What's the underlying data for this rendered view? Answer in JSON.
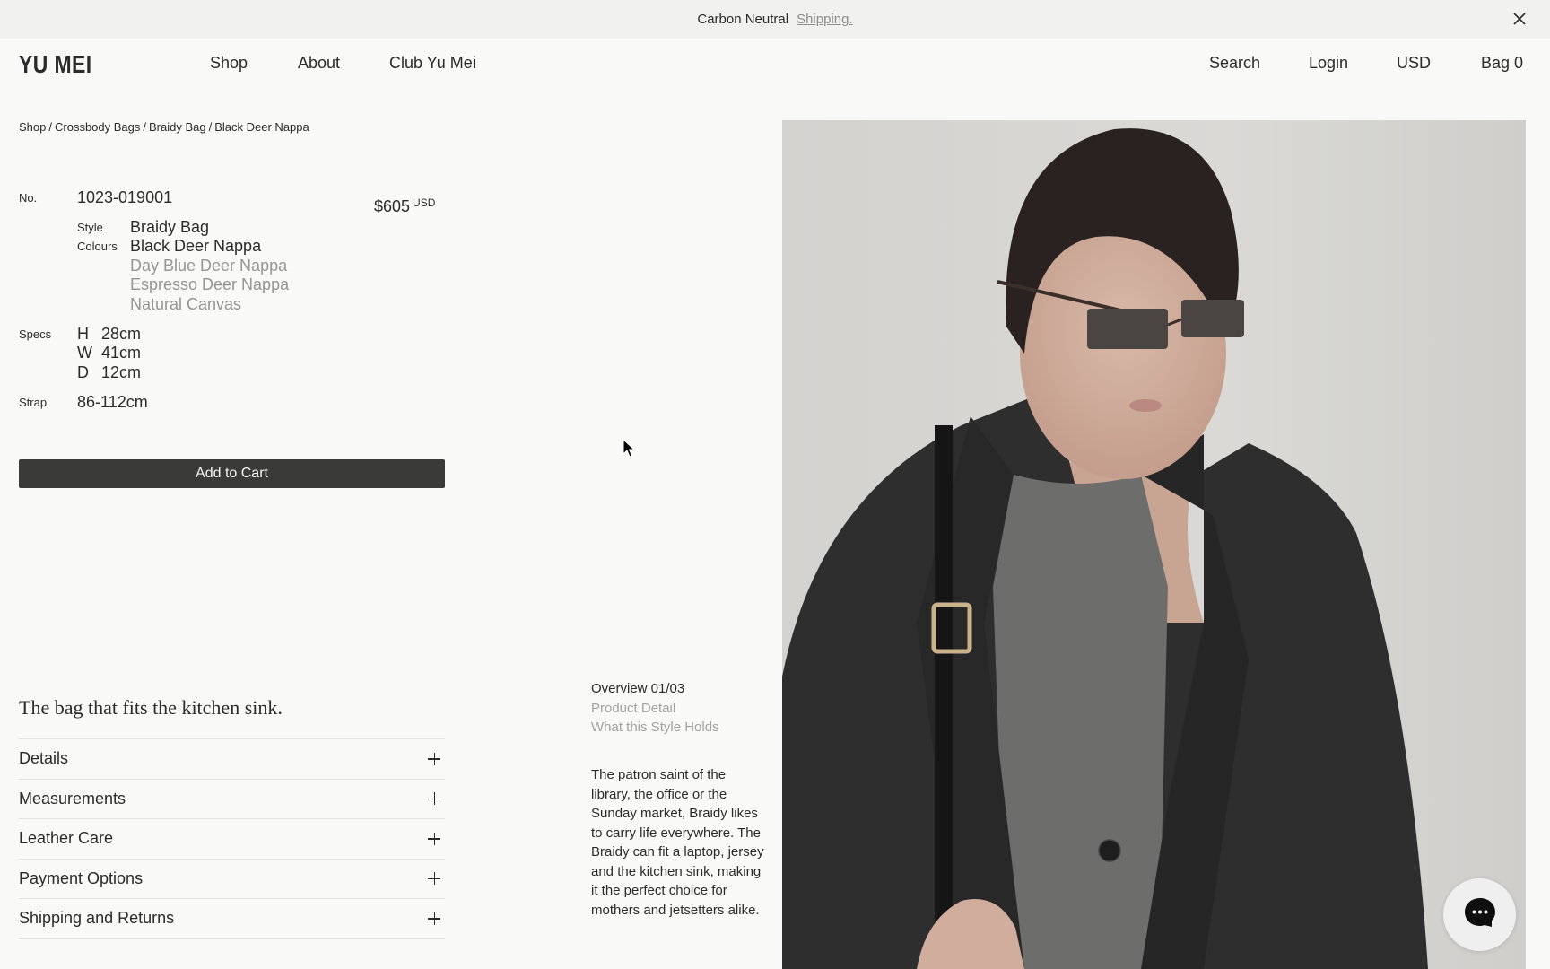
{
  "announcement": {
    "text": "Carbon Neutral",
    "link": "Shipping.",
    "close_icon": "close-icon"
  },
  "nav": {
    "logo": "YU MEI",
    "left": [
      "Shop",
      "About",
      "Club Yu Mei"
    ],
    "right": [
      "Search",
      "Login",
      "USD",
      "Bag 0"
    ]
  },
  "breadcrumb": [
    "Shop",
    "Crossbody Bags",
    "Braidy Bag",
    "Black Deer Nappa"
  ],
  "breadcrumb_separator": "/",
  "product": {
    "number_label": "No.",
    "number": "1023-019001",
    "price": "$605",
    "currency": "USD",
    "style_label": "Style",
    "style": "Braidy Bag",
    "colours_label": "Colours",
    "colours": [
      {
        "name": "Black Deer Nappa",
        "selected": true
      },
      {
        "name": "Day Blue Deer Nappa",
        "selected": false
      },
      {
        "name": "Espresso Deer Nappa",
        "selected": false
      },
      {
        "name": "Natural Canvas",
        "selected": false
      }
    ],
    "specs_label": "Specs",
    "specs": [
      {
        "k": "H",
        "v": "28cm"
      },
      {
        "k": "W",
        "v": "41cm"
      },
      {
        "k": "D",
        "v": "12cm"
      }
    ],
    "strap_label": "Strap",
    "strap": "86-112cm",
    "add_to_cart": "Add to Cart"
  },
  "tagline": "The bag that fits the kitchen sink.",
  "accordion": [
    "Details",
    "Measurements",
    "Leather Care",
    "Payment Options",
    "Shipping and Returns"
  ],
  "overview": {
    "items": [
      {
        "label": "Overview 01/03",
        "active": true
      },
      {
        "label": "Product Detail",
        "active": false
      },
      {
        "label": "What this Style Holds",
        "active": false
      }
    ],
    "text": "The patron saint of the library, the office or the Sunday market, Braidy likes to carry life everywhere. The Braidy can fit a laptop, jersey and the kitchen sink, making it the perfect choice for mothers and jetsetters alike."
  },
  "hero_image": {
    "alt": "Model in black blazer wearing sunglasses carrying the Braidy Bag in Black Deer Nappa"
  },
  "chat_widget": {
    "icon": "chat-bubble-icon"
  },
  "colors": {
    "text": "#2b2b2b",
    "muted": "#959595",
    "button": "#3a3a39",
    "background": "#f9f9f8",
    "banner": "#f1f1ef"
  }
}
